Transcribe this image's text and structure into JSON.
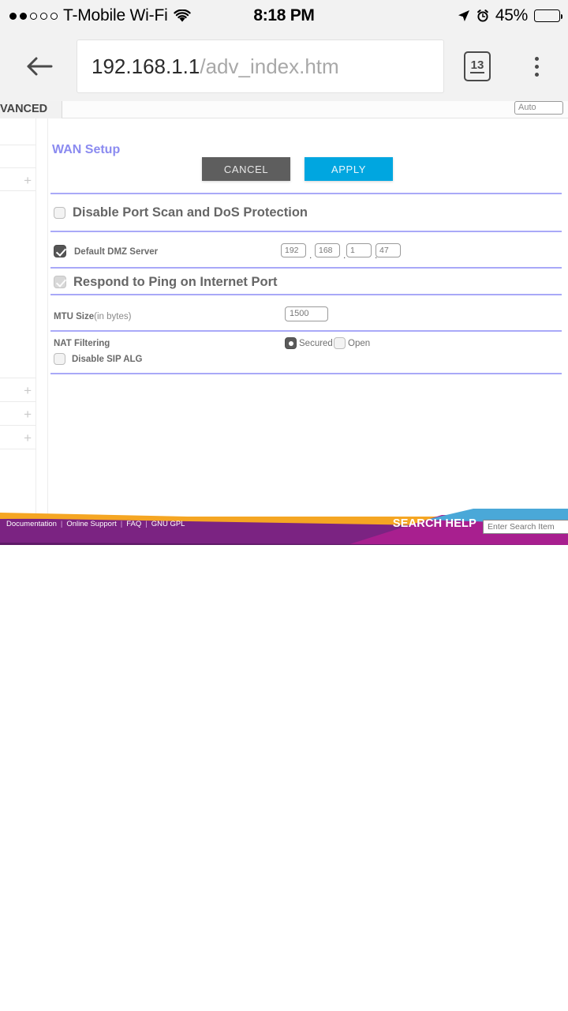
{
  "status_bar": {
    "signal_filled": 2,
    "signal_total": 5,
    "carrier": "T-Mobile Wi-Fi",
    "wifi_icon": "wifi-icon",
    "time": "8:18 PM",
    "location_icon": "location-arrow-icon",
    "alarm_icon": "alarm-clock-icon",
    "battery_percent": "45%",
    "battery_level": 45
  },
  "browser": {
    "back_icon": "back-arrow-icon",
    "url_host": "192.168.1.1",
    "url_path": "/adv_index.htm",
    "tab_count": "13",
    "menu_icon": "overflow-menu-icon"
  },
  "page": {
    "tab_label": "VANCED",
    "auto_field_value": "Auto",
    "section_title": "WAN Setup",
    "buttons": {
      "cancel": "CANCEL",
      "apply": "APPLY"
    },
    "rows": {
      "port_scan_label": "Disable Port Scan and DoS Protection",
      "dmz_label": "Default DMZ Server",
      "dmz_ip": [
        "192",
        "168",
        "1",
        "47"
      ],
      "dmz_ip_sep": ".",
      "ping_label": "Respond to Ping on Internet Port",
      "mtu_label_bold": "MTU Size",
      "mtu_label_reg": "(in bytes)",
      "mtu_value": "1500",
      "nat_label": "NAT Filtering",
      "nat_option_secured": "Secured",
      "nat_option_open": "Open",
      "sip_label": "Disable SIP ALG"
    },
    "sidebar_expanders": [
      "+",
      "+",
      "+",
      "+"
    ],
    "colors": {
      "accent_purple": "#8b8bf0",
      "divider": "#a9a9f8",
      "apply_blue": "#00a6e0",
      "cancel_gray": "#5e5e5e",
      "footer_purple": "#7b2382",
      "footer_magenta": "#a81f8f",
      "footer_orange": "#f5a623",
      "footer_blue": "#4aa8d8"
    }
  },
  "footer": {
    "links": [
      "Documentation",
      "Online Support",
      "FAQ",
      "GNU GPL"
    ],
    "separator": "|",
    "search_help_label": "SEARCH HELP",
    "search_placeholder": "Enter Search Item",
    "search_value": ""
  }
}
